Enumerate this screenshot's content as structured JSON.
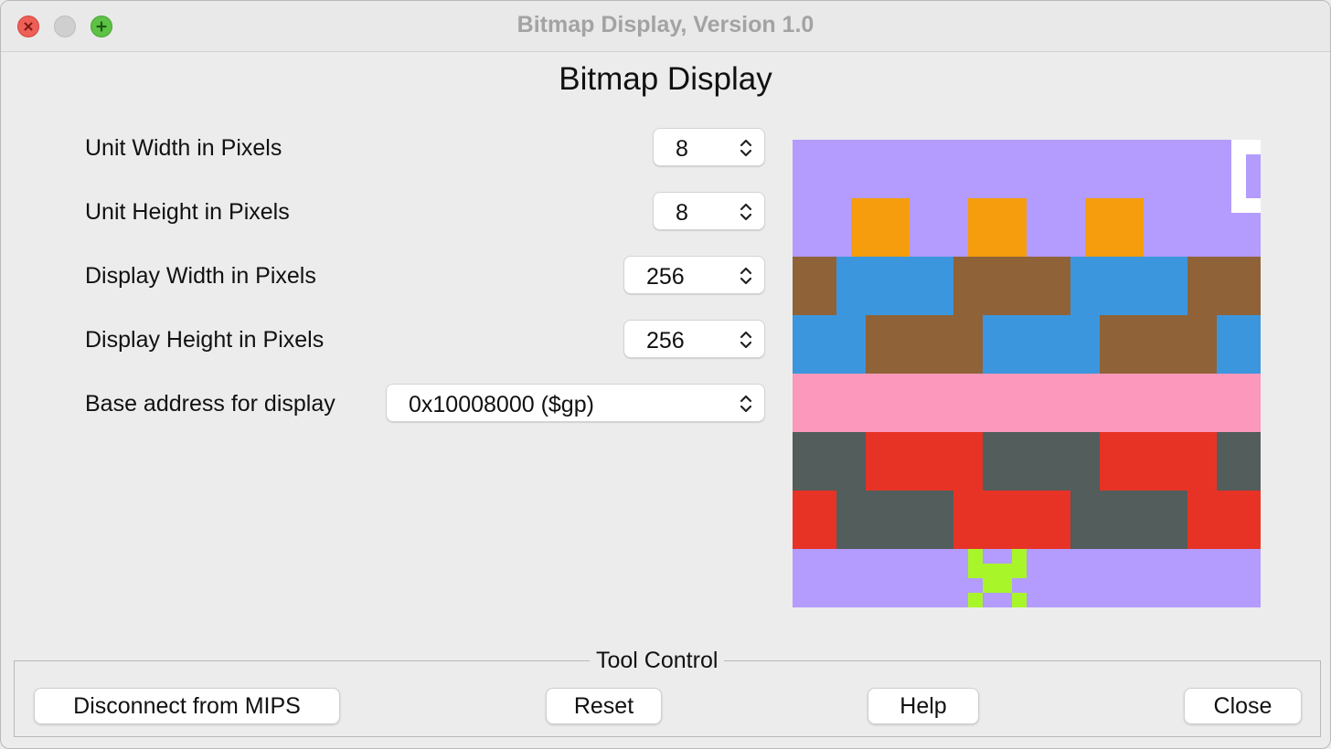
{
  "window": {
    "title": "Bitmap Display, Version 1.0"
  },
  "heading": "Bitmap Display",
  "settings": {
    "unit_width": {
      "label": "Unit Width in Pixels",
      "value": "8"
    },
    "unit_height": {
      "label": "Unit Height in Pixels",
      "value": "8"
    },
    "display_width": {
      "label": "Display Width in Pixels",
      "value": "256"
    },
    "display_height": {
      "label": "Display Height in Pixels",
      "value": "256"
    },
    "base_address": {
      "label": "Base address for display",
      "value": "0x10008000 ($gp)"
    }
  },
  "bitmap": {
    "grid_units": 32,
    "palette": {
      "P": "#b39cfd",
      "O": "#f69d0d",
      "W": "#ffffff",
      "B": "#3c96dd",
      "N": "#8f6237",
      "K": "#fb98bb",
      "G": "#525d5c",
      "R": "#e73326",
      "L": "#a8f52a"
    },
    "rows": [
      "PPPPPPPPPPPPPPPPPPPPPPPPPPPPPPWW",
      "PPPPPPPPPPPPPPPPPPPPPPPPPPPPPPWP",
      "PPPPPPPPPPPPPPPPPPPPPPPPPPPPPPWP",
      "PPPPPPPPPPPPPPPPPPPPPPPPPPPPPPWP",
      "PPPPOOOOPPPPOOOOPPPPOOOOPPPPPPWW",
      "PPPPOOOOPPPPOOOOPPPPOOOOPPPPPPPP",
      "PPPPOOOOPPPPOOOOPPPPOOOOPPPPPPPP",
      "PPPPOOOOPPPPOOOOPPPPOOOOPPPPPPPP",
      "NNNBBBBBBBBNNNNNNNNBBBBBBBBNNNNN",
      "NNNBBBBBBBBNNNNNNNNBBBBBBBBNNNNN",
      "NNNBBBBBBBBNNNNNNNNBBBBBBBBNNNNN",
      "NNNBBBBBBBBNNNNNNNNBBBBBBBBNNNNN",
      "BBBBBNNNNNNNNBBBBBBBBNNNNNNNNBBB",
      "BBBBBNNNNNNNNBBBBBBBBNNNNNNNNBBB",
      "BBBBBNNNNNNNNBBBBBBBBNNNNNNNNBBB",
      "BBBBBNNNNNNNNBBBBBBBBNNNNNNNNBBB",
      "KKKKKKKKKKKKKKKKKKKKKKKKKKKKKKKK",
      "KKKKKKKKKKKKKKKKKKKKKKKKKKKKKKKK",
      "KKKKKKKKKKKKKKKKKKKKKKKKKKKKKKKK",
      "KKKKKKKKKKKKKKKKKKKKKKKKKKKKKKKK",
      "GGGGGRRRRRRRRGGGGGGGGRRRRRRRRGGG",
      "GGGGGRRRRRRRRGGGGGGGGRRRRRRRRGGG",
      "GGGGGRRRRRRRRGGGGGGGGRRRRRRRRGGG",
      "GGGGGRRRRRRRRGGGGGGGGRRRRRRRRGGG",
      "RRRGGGGGGGGRRRRRRRRGGGGGGGGRRRRR",
      "RRRGGGGGGGGRRRRRRRRGGGGGGGGRRRRR",
      "RRRGGGGGGGGRRRRRRRRGGGGGGGGRRRRR",
      "RRRGGGGGGGGRRRRRRRRGGGGGGGGRRRRR",
      "PPPPPPPPPPPPLPPLPPPPPPPPPPPPPPPP",
      "PPPPPPPPPPPPLLLLPPPPPPPPPPPPPPPP",
      "PPPPPPPPPPPPPLLPPPPPPPPPPPPPPPPP",
      "PPPPPPPPPPPPLPPLPPPPPPPPPPPPPPPP"
    ]
  },
  "tool_control": {
    "legend": "Tool Control",
    "disconnect_label": "Disconnect from MIPS",
    "reset_label": "Reset",
    "help_label": "Help",
    "close_label": "Close"
  }
}
